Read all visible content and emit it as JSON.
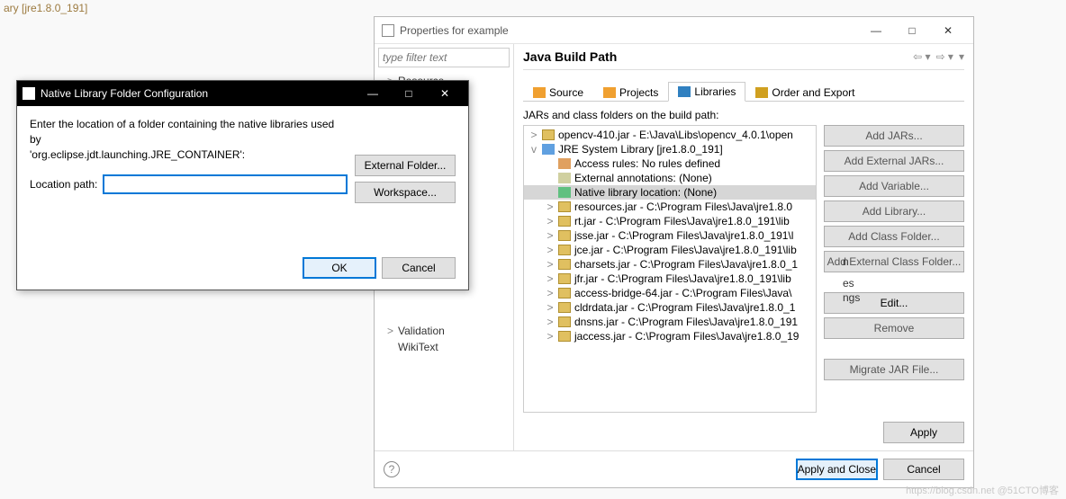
{
  "bg": {
    "text": "ary [jre1.8.0_191]"
  },
  "props": {
    "title": "Properties for example",
    "filter_placeholder": "type filter text",
    "categories": [
      {
        "label": "Resource",
        "expand": ">"
      },
      {
        "label": "Validation",
        "expand": ">"
      },
      {
        "label": "WikiText",
        "expand": ""
      }
    ],
    "partials": [
      "n",
      "es",
      "ngs"
    ],
    "heading": "Java Build Path",
    "tabs": {
      "source": "Source",
      "projects": "Projects",
      "libraries": "Libraries",
      "order": "Order and Export"
    },
    "build_label": "JARs and class folders on the build path:",
    "tree": [
      {
        "pad": 0,
        "tw": ">",
        "ic": "jic-jar",
        "label": "opencv-410.jar - E:\\Java\\Libs\\opencv_4.0.1\\open"
      },
      {
        "pad": 0,
        "tw": "v",
        "ic": "jic-lib",
        "label": "JRE System Library [jre1.8.0_191]"
      },
      {
        "pad": 1,
        "tw": "",
        "ic": "jic-rule",
        "label": "Access rules: No rules defined"
      },
      {
        "pad": 1,
        "tw": "",
        "ic": "jic-ann",
        "label": "External annotations: (None)"
      },
      {
        "pad": 1,
        "tw": "",
        "ic": "jic-native",
        "label": "Native library location: (None)",
        "sel": true
      },
      {
        "pad": 1,
        "tw": ">",
        "ic": "jic-jar",
        "label": "resources.jar - C:\\Program Files\\Java\\jre1.8.0"
      },
      {
        "pad": 1,
        "tw": ">",
        "ic": "jic-jar",
        "label": "rt.jar - C:\\Program Files\\Java\\jre1.8.0_191\\lib"
      },
      {
        "pad": 1,
        "tw": ">",
        "ic": "jic-jar",
        "label": "jsse.jar - C:\\Program Files\\Java\\jre1.8.0_191\\l"
      },
      {
        "pad": 1,
        "tw": ">",
        "ic": "jic-jar",
        "label": "jce.jar - C:\\Program Files\\Java\\jre1.8.0_191\\lib"
      },
      {
        "pad": 1,
        "tw": ">",
        "ic": "jic-jar",
        "label": "charsets.jar - C:\\Program Files\\Java\\jre1.8.0_1"
      },
      {
        "pad": 1,
        "tw": ">",
        "ic": "jic-jar",
        "label": "jfr.jar - C:\\Program Files\\Java\\jre1.8.0_191\\lib"
      },
      {
        "pad": 1,
        "tw": ">",
        "ic": "jic-jar",
        "label": "access-bridge-64.jar - C:\\Program Files\\Java\\"
      },
      {
        "pad": 1,
        "tw": ">",
        "ic": "jic-jar",
        "label": "cldrdata.jar - C:\\Program Files\\Java\\jre1.8.0_1"
      },
      {
        "pad": 1,
        "tw": ">",
        "ic": "jic-jar",
        "label": "dnsns.jar - C:\\Program Files\\Java\\jre1.8.0_191"
      },
      {
        "pad": 1,
        "tw": ">",
        "ic": "jic-jar",
        "label": "jaccess.jar - C:\\Program Files\\Java\\jre1.8.0_19"
      }
    ],
    "side_buttons": {
      "add_jars": "Add JARs...",
      "add_ext_jars": "Add External JARs...",
      "add_var": "Add Variable...",
      "add_lib": "Add Library...",
      "add_class": "Add Class Folder...",
      "add_ext_class": "Add External Class Folder...",
      "edit": "Edit...",
      "remove": "Remove",
      "migrate": "Migrate JAR File..."
    },
    "apply": "Apply",
    "apply_close": "Apply and Close",
    "cancel": "Cancel"
  },
  "native": {
    "title": "Native Library Folder Configuration",
    "msg1": "Enter the location of a folder containing the native libraries used by",
    "msg2": "'org.eclipse.jdt.launching.JRE_CONTAINER':",
    "loc_label": "Location path:",
    "loc_value": "",
    "ext_folder": "External Folder...",
    "workspace": "Workspace...",
    "ok": "OK",
    "cancel": "Cancel"
  },
  "watermark": "https://blog.csdn.net @51CTO博客"
}
